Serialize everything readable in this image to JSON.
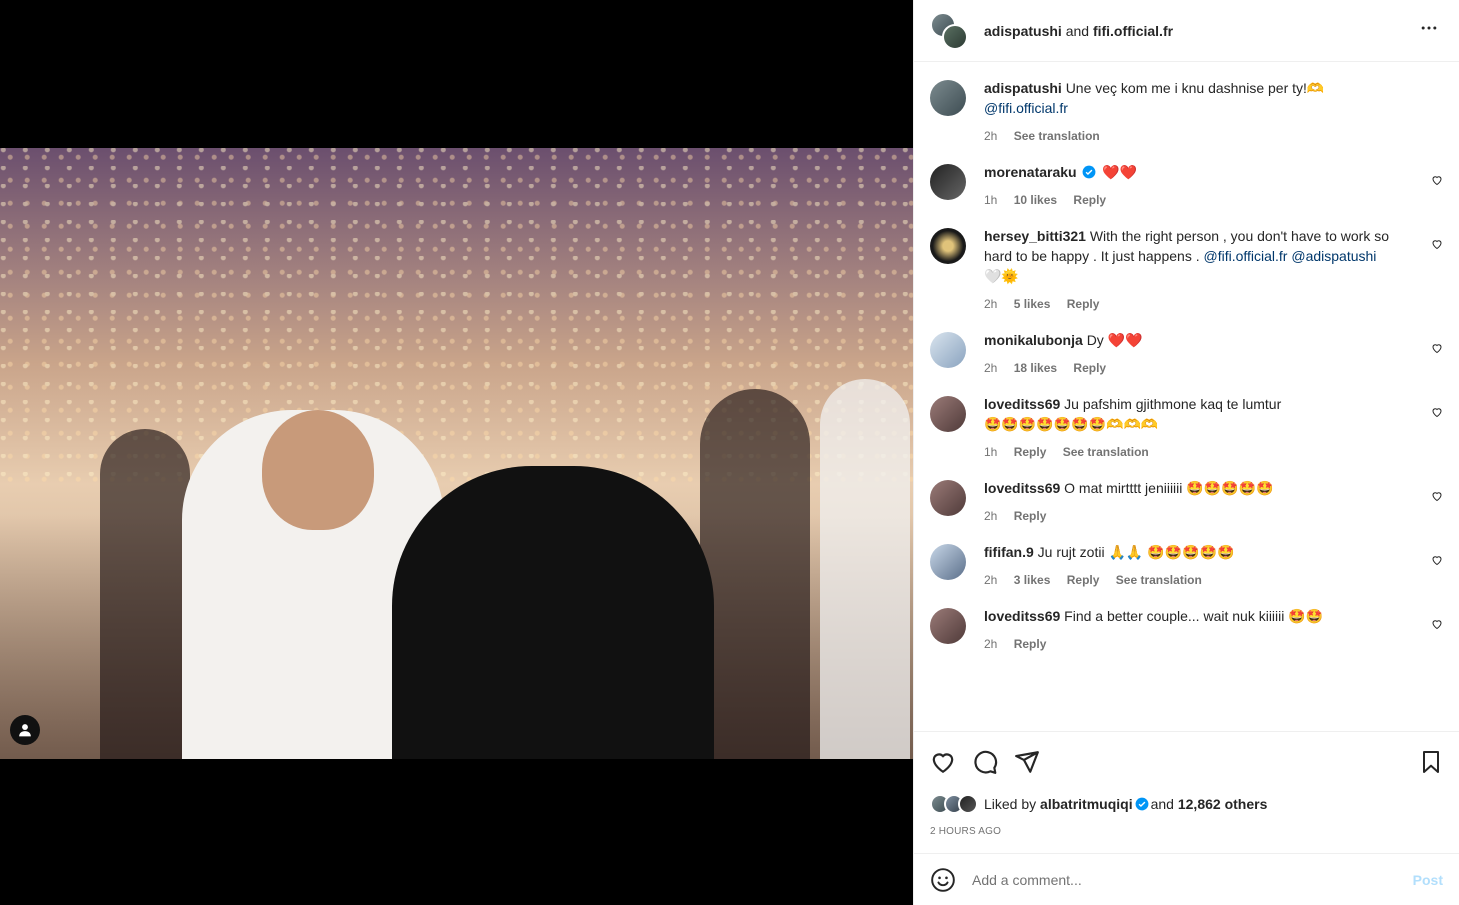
{
  "header": {
    "user1": "adispatushi",
    "joiner": "and",
    "user2": "fifi.official.fr",
    "more_icon": "more-horizontal-icon"
  },
  "caption": {
    "user": "adispatushi",
    "text": "Une veç kom me i knu dashnise per ty!",
    "emoji_suffix": "🫶",
    "mention": "@fifi.official.fr",
    "time": "2h",
    "translate": "See translation"
  },
  "comments": [
    {
      "user": "morenataraku",
      "verified": true,
      "text": "",
      "emoji": "❤️❤️",
      "time": "1h",
      "likes": "10 likes",
      "reply": "Reply"
    },
    {
      "user": "hersey_bitti321",
      "verified": false,
      "text": "With the right person , you don't have to work so hard to be happy . It just happens .",
      "mention1": "@fifi.official.fr",
      "mention2": "@adispatushi",
      "emoji": "🤍🌞",
      "time": "2h",
      "likes": "5 likes",
      "reply": "Reply"
    },
    {
      "user": "monikalubonja",
      "verified": false,
      "text": "Dy",
      "emoji": "❤️❤️",
      "time": "2h",
      "likes": "18 likes",
      "reply": "Reply"
    },
    {
      "user": "loveditss69",
      "verified": false,
      "text": "Ju pafshim gjithmone kaq te lumtur",
      "emoji": "🤩🤩🤩🤩🤩🤩🤩🫶🫶🫶",
      "time": "1h",
      "reply": "Reply",
      "translate": "See translation"
    },
    {
      "user": "loveditss69",
      "verified": false,
      "text": "O mat mirtttt jeniiiiii",
      "emoji": "🤩🤩🤩🤩🤩",
      "time": "2h",
      "reply": "Reply"
    },
    {
      "user": "fififan.9",
      "verified": false,
      "text": "Ju rujt zotii",
      "emoji": "🙏🙏 🤩🤩🤩🤩🤩",
      "time": "2h",
      "likes": "3 likes",
      "reply": "Reply",
      "translate": "See translation"
    },
    {
      "user": "loveditss69",
      "verified": false,
      "text": "Find a better couple... wait nuk kiiiiii",
      "emoji": "🤩🤩",
      "time": "2h",
      "reply": "Reply"
    }
  ],
  "actions": {
    "like_icon": "heart-icon",
    "comment_icon": "comment-icon",
    "share_icon": "share-icon",
    "save_icon": "bookmark-icon"
  },
  "likes": {
    "prefix": "Liked by",
    "user": "albatritmuqiqi",
    "joiner": "and",
    "others": "12,862 others"
  },
  "timestamp": "2 HOURS AGO",
  "add_comment": {
    "placeholder": "Add a comment...",
    "post_label": "Post",
    "emoji_icon": "emoji-smile-icon"
  },
  "colors": {
    "link": "#00376b",
    "verified": "#0095f6",
    "post_disabled": "#b2dffc",
    "muted": "#737373"
  }
}
